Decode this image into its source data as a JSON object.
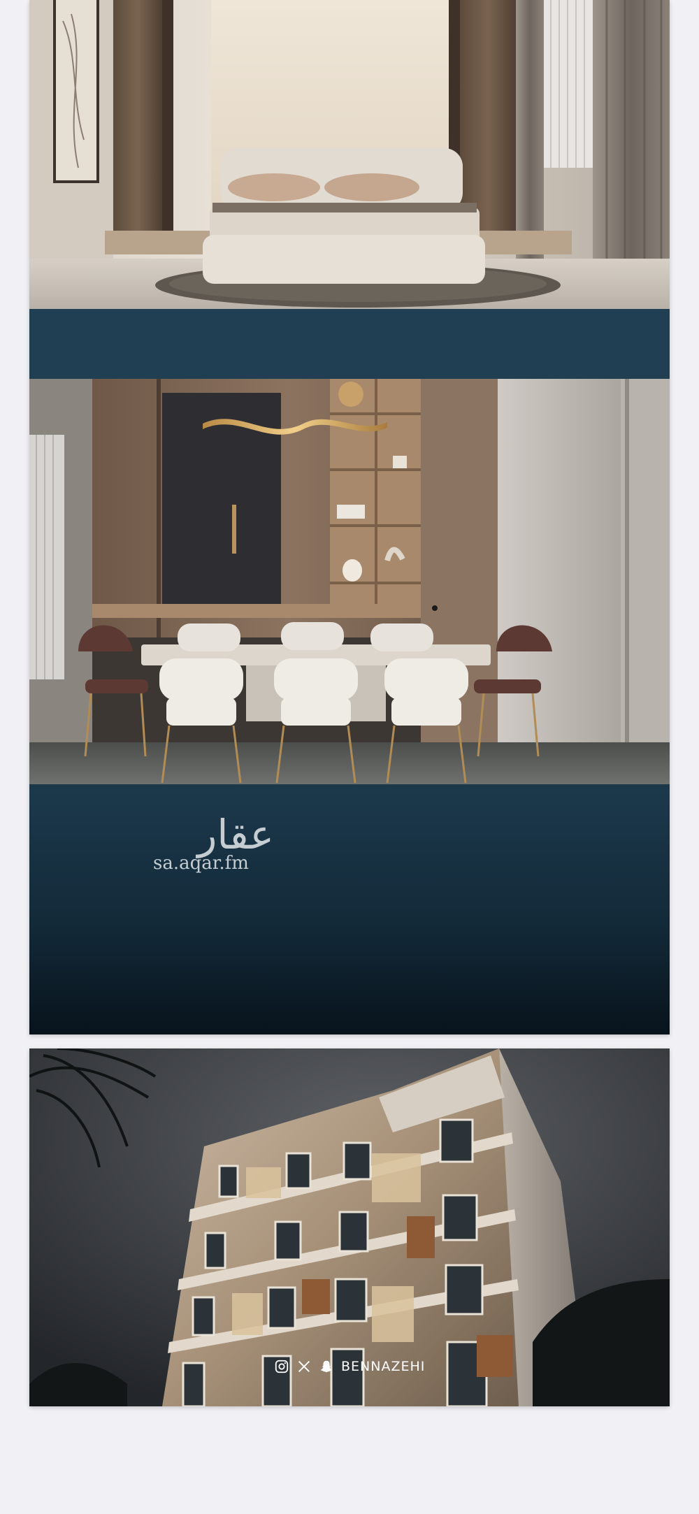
{
  "logo": {
    "arabic_name": "عقار",
    "site": "sa.aqar.fm"
  },
  "watermark": {
    "icons": [
      "instagram-icon",
      "x-logo-icon",
      "snapchat-icon"
    ],
    "handle": "BENNAZEHI"
  },
  "colors": {
    "page_background": "#f1f1f5",
    "band": "#213f52",
    "panel_top": "#1c394c",
    "panel_bottom": "#08131c",
    "logo_text": "#c5cdd2"
  }
}
